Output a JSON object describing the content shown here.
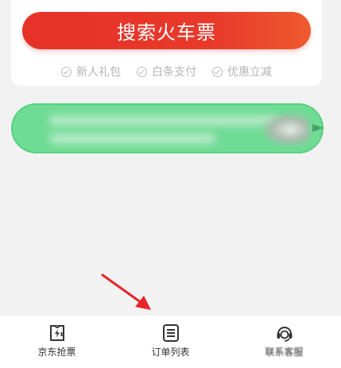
{
  "search": {
    "button_label": "搜索火车票",
    "perks": [
      "新人礼包",
      "白条支付",
      "优惠立减"
    ]
  },
  "promo": {
    "icon": "blurred-banner"
  },
  "tabbar": {
    "items": [
      {
        "label": "京东抢票",
        "icon": "ticket-lightning-icon"
      },
      {
        "label": "订单列表",
        "icon": "document-list-icon"
      },
      {
        "label": "联系客服",
        "icon": "headset-icon"
      }
    ]
  },
  "colors": {
    "accent": "#e8392a",
    "promo_bg": "#6fdc95",
    "annotation_arrow": "#e6262a"
  }
}
